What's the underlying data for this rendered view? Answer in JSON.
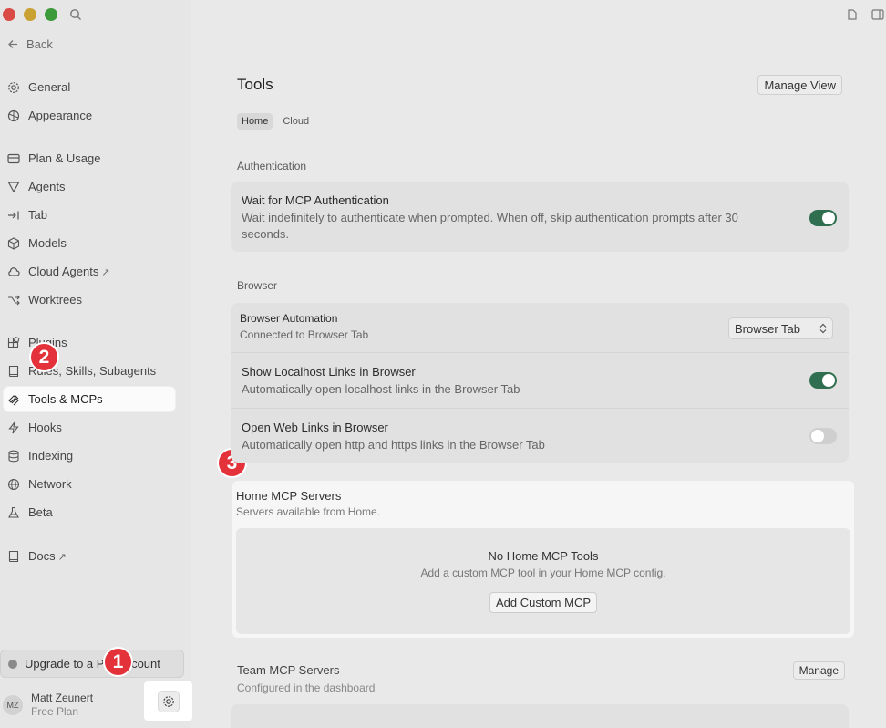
{
  "window": {
    "back_label": "Back"
  },
  "sidebar": {
    "items": [
      {
        "label": "General",
        "icon": "gear-icon"
      },
      {
        "label": "Appearance",
        "icon": "palette-icon"
      },
      {
        "label": "Plan & Usage",
        "icon": "card-icon"
      },
      {
        "label": "Agents",
        "icon": "agents-icon"
      },
      {
        "label": "Tab",
        "icon": "tab-arrow-icon"
      },
      {
        "label": "Models",
        "icon": "cube-icon"
      },
      {
        "label": "Cloud Agents",
        "icon": "cloud-icon"
      },
      {
        "label": "Worktrees",
        "icon": "branch-icon"
      },
      {
        "label": "Plugins",
        "icon": "plugin-icon"
      },
      {
        "label": "Rules, Skills, Subagents",
        "icon": "book-icon"
      },
      {
        "label": "Tools & MCPs",
        "icon": "tools-icon"
      },
      {
        "label": "Hooks",
        "icon": "bolt-icon"
      },
      {
        "label": "Indexing",
        "icon": "database-icon"
      },
      {
        "label": "Network",
        "icon": "globe-icon"
      },
      {
        "label": "Beta",
        "icon": "flask-icon"
      },
      {
        "label": "Docs",
        "icon": "docs-icon"
      }
    ],
    "external_arrow": "↗",
    "upgrade_label": "Upgrade to a Pro Account",
    "user": {
      "initials": "MZ",
      "name": "Matt Zeunert",
      "plan": "Free Plan"
    }
  },
  "annotations": {
    "badge1": "1",
    "badge2": "2",
    "badge3": "3"
  },
  "main": {
    "title": "Tools",
    "manage_view_label": "Manage View",
    "tabs": [
      {
        "label": "Home",
        "active": true
      },
      {
        "label": "Cloud",
        "active": false
      }
    ],
    "authentication": {
      "label": "Authentication",
      "wait_title": "Wait for MCP Authentication",
      "wait_desc": "Wait indefinitely to authenticate when prompted. When off, skip authentication prompts after 30 seconds.",
      "wait_on": true
    },
    "browser": {
      "label": "Browser",
      "automation_title": "Browser Automation",
      "automation_desc": "Connected to Browser Tab",
      "automation_select": "Browser Tab",
      "localhost_title": "Show Localhost Links in Browser",
      "localhost_desc": "Automatically open localhost links in the Browser Tab",
      "localhost_on": true,
      "weblinks_title": "Open Web Links in Browser",
      "weblinks_desc": "Automatically open http and https links in the Browser Tab",
      "weblinks_on": false
    },
    "home_mcp": {
      "title": "Home MCP Servers",
      "subtitle": "Servers available from Home.",
      "empty_title": "No Home MCP Tools",
      "empty_desc": "Add a custom MCP tool in your Home MCP config.",
      "add_button": "Add Custom MCP"
    },
    "team_mcp": {
      "title": "Team MCP Servers",
      "subtitle": "Configured in the dashboard",
      "manage_label": "Manage"
    }
  },
  "colors": {
    "toggle_on": "#2f6f4f",
    "badge": "#e3323a"
  }
}
